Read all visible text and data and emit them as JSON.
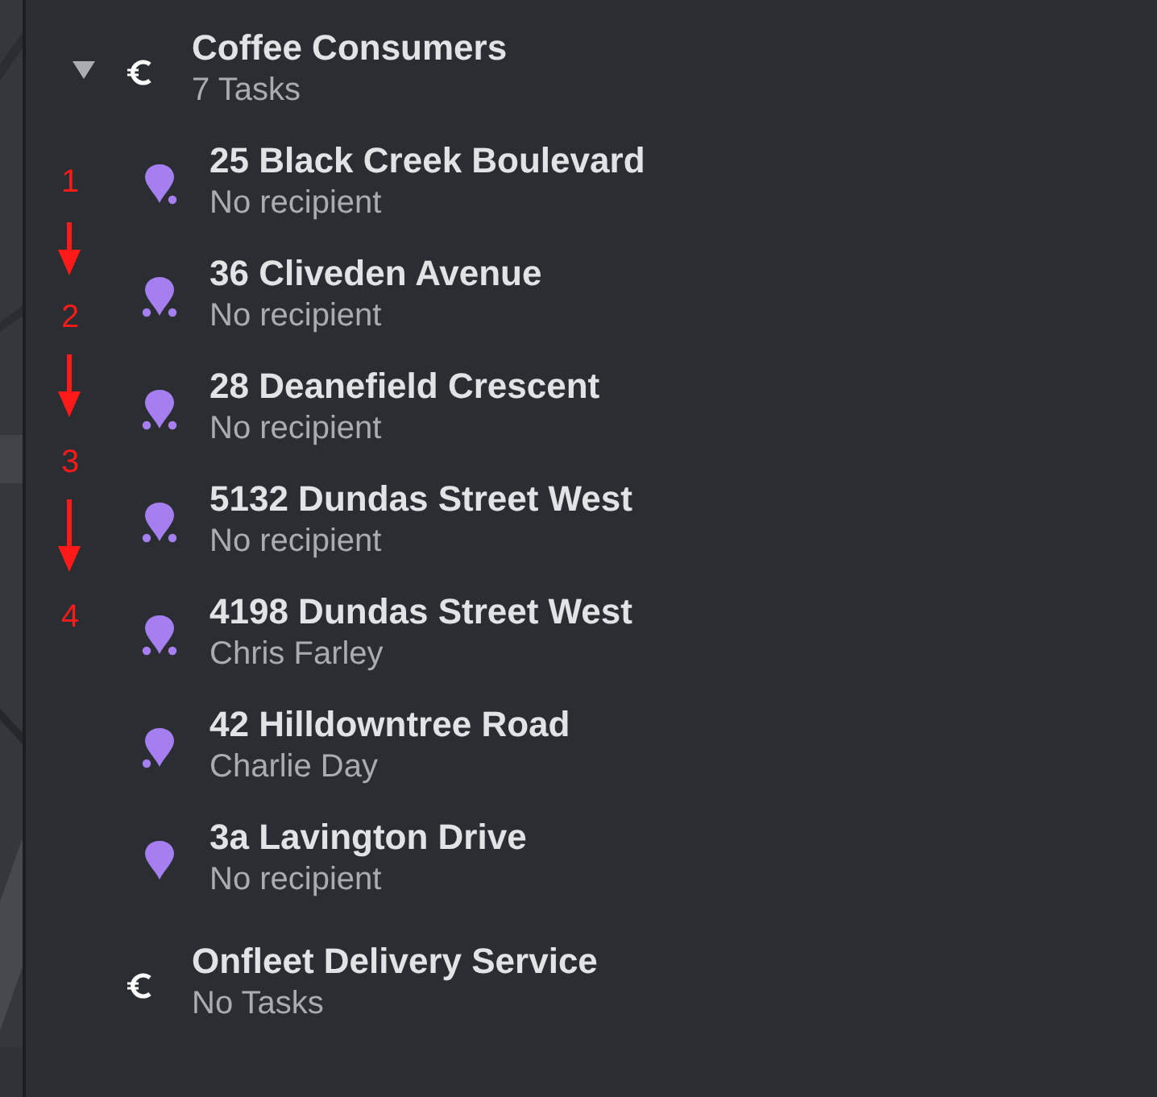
{
  "teams": [
    {
      "name": "Coffee Consumers",
      "count": "7 Tasks",
      "expanded": true,
      "tasks": [
        {
          "address": "25 Black Creek Boulevard",
          "recipient": "No recipient",
          "has_predecessor": false,
          "has_successor": true
        },
        {
          "address": "36 Cliveden Avenue",
          "recipient": "No recipient",
          "has_predecessor": true,
          "has_successor": true
        },
        {
          "address": "28 Deanefield Crescent",
          "recipient": "No recipient",
          "has_predecessor": true,
          "has_successor": true
        },
        {
          "address": "5132 Dundas Street West",
          "recipient": "No recipient",
          "has_predecessor": true,
          "has_successor": true
        },
        {
          "address": "4198 Dundas Street West",
          "recipient": "Chris Farley",
          "has_predecessor": true,
          "has_successor": true
        },
        {
          "address": "42 Hilldowntree Road",
          "recipient": "Charlie Day",
          "has_predecessor": true,
          "has_successor": false
        },
        {
          "address": "3a Lavington Drive",
          "recipient": "No recipient",
          "has_predecessor": false,
          "has_successor": false
        }
      ]
    },
    {
      "name": "Onfleet Delivery Service",
      "count": "No Tasks"
    }
  ],
  "annotations": [
    {
      "label": "1"
    },
    {
      "label": "2"
    },
    {
      "label": "3"
    },
    {
      "label": "4"
    }
  ]
}
